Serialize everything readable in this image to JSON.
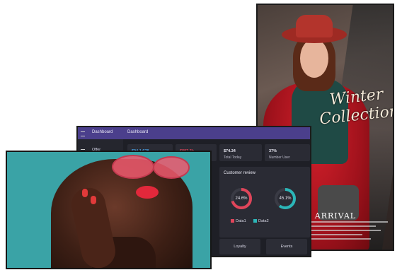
{
  "portrait_display": {
    "headline_line1": "Winter",
    "headline_line2": "Collection",
    "subheadline": "W ARRIVAL"
  },
  "dashboard": {
    "sidebar_brand": "Dashboard",
    "header_title": "Dashboard",
    "sidebar_items": [
      {
        "label": "Offer"
      }
    ],
    "stats": [
      {
        "value": "$94,1,678",
        "label": "",
        "color": "#4aa3e8"
      },
      {
        "value": "$897.3k",
        "label": "",
        "color": "#e0455a"
      },
      {
        "value": "$74.34",
        "label": "Total Today",
        "color": "#e9e9f3"
      },
      {
        "value": "37%",
        "label": "Number User",
        "color": "#e9e9f3"
      }
    ],
    "review": {
      "title": "Customer review",
      "donuts": [
        {
          "label": "24.6%",
          "color": "#e0455a",
          "fraction": 0.7
        },
        {
          "label": "45.1%",
          "color": "#2bb6b8",
          "fraction": 0.6
        }
      ],
      "legend": [
        {
          "label": "Data1",
          "color": "#e0455a"
        },
        {
          "label": "Data2",
          "color": "#2bb6b8"
        }
      ]
    },
    "buttons": {
      "loyalty": "Loyalty",
      "events": "Events"
    }
  }
}
